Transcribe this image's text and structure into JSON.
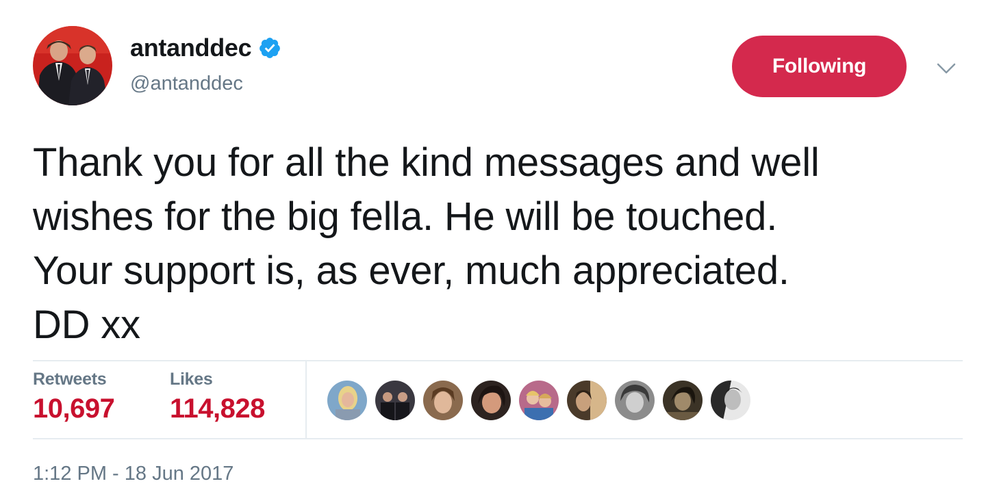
{
  "user": {
    "display_name": "antanddec",
    "handle": "@antanddec",
    "verified": true
  },
  "follow_button": {
    "label": "Following"
  },
  "tweet": {
    "lines": [
      "Thank you for all the kind messages and well",
      "wishes for the big fella. He will be touched.",
      "Your support is, as ever, much appreciated.",
      "DD xx"
    ]
  },
  "stats": {
    "retweets_label": "Retweets",
    "retweets_value": "10,697",
    "likes_label": "Likes",
    "likes_value": "114,828"
  },
  "timestamp": "1:12 PM - 18 Jun 2017",
  "icons": {
    "verified": "verified-badge-icon",
    "chevron": "chevron-down-icon"
  },
  "colors": {
    "follow_button_bg": "#d4294d",
    "stat_value": "#c8102e",
    "verified_blue": "#1da1f2",
    "muted_text": "#657786",
    "divider": "#e6ecf0"
  },
  "likers": [
    "liker-avatar-1",
    "liker-avatar-2",
    "liker-avatar-3",
    "liker-avatar-4",
    "liker-avatar-5",
    "liker-avatar-6",
    "liker-avatar-7",
    "liker-avatar-8",
    "liker-avatar-9"
  ]
}
